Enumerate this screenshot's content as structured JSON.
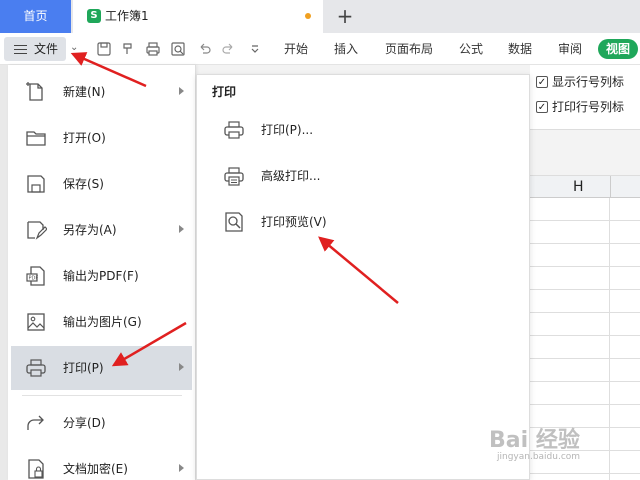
{
  "tabs": {
    "home": "首页",
    "doc_icon": "S",
    "doc_title": "工作簿1",
    "add": "+"
  },
  "toolbar": {
    "file_label": "文件",
    "ribbon_tabs": [
      "开始",
      "插入",
      "页面布局",
      "公式",
      "数据",
      "审阅",
      "视图"
    ]
  },
  "options": {
    "show_headers": "显示行号列标",
    "print_headers": "打印行号列标"
  },
  "column_header": "H",
  "file_menu": {
    "items": [
      {
        "label": "新建(N)",
        "icon": "new-icon"
      },
      {
        "label": "打开(O)",
        "icon": "folder-icon"
      },
      {
        "label": "保存(S)",
        "icon": "save-icon"
      },
      {
        "label": "另存为(A)",
        "icon": "save-as-icon"
      },
      {
        "label": "输出为PDF(F)",
        "icon": "pdf-icon"
      },
      {
        "label": "输出为图片(G)",
        "icon": "image-icon"
      },
      {
        "label": "打印(P)",
        "icon": "printer-icon"
      },
      {
        "label": "分享(D)",
        "icon": "share-icon"
      },
      {
        "label": "文档加密(E)",
        "icon": "lock-icon"
      }
    ]
  },
  "print_submenu": {
    "title": "打印",
    "items": [
      {
        "label": "打印(P)...",
        "icon": "printer-icon"
      },
      {
        "label": "高级打印...",
        "icon": "advanced-print-icon"
      },
      {
        "label": "打印预览(V)",
        "icon": "print-preview-icon"
      }
    ]
  },
  "watermark": {
    "logo": "Bai 经验",
    "url": "jingyan.baidu.com"
  },
  "colors": {
    "accent_blue": "#4a7ef0",
    "accent_green": "#1fa75a",
    "annotation_arrow": "#e02020"
  }
}
